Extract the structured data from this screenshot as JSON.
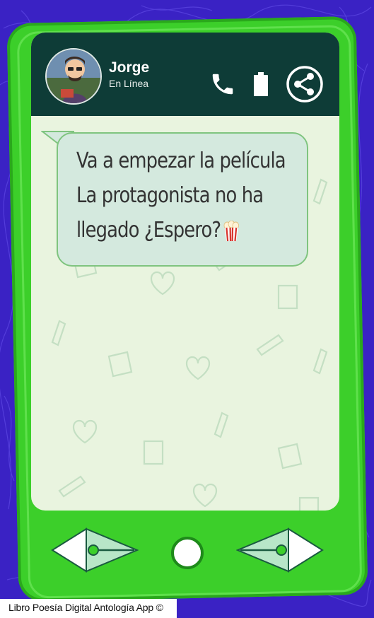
{
  "contact": {
    "name": "Jorge",
    "status": "En Línea"
  },
  "header_icons": [
    "phone-icon",
    "battery-icon",
    "share-icon"
  ],
  "message": {
    "lines": [
      "Va a empezar la película",
      "La protagonista no ha",
      "llegado ¿Espero?"
    ],
    "emoji": "popcorn-icon"
  },
  "nav": {
    "left": "arrow-left-icon",
    "home": "home-button",
    "right": "arrow-right-icon"
  },
  "footer": {
    "credit": "Libro Poesía Digital Antología App ©"
  },
  "colors": {
    "background": "#3a22c4",
    "phone": "#3ccf2a",
    "header": "#0e3c37",
    "bubble": "#d4e9de",
    "screen": "#e9f4df"
  }
}
